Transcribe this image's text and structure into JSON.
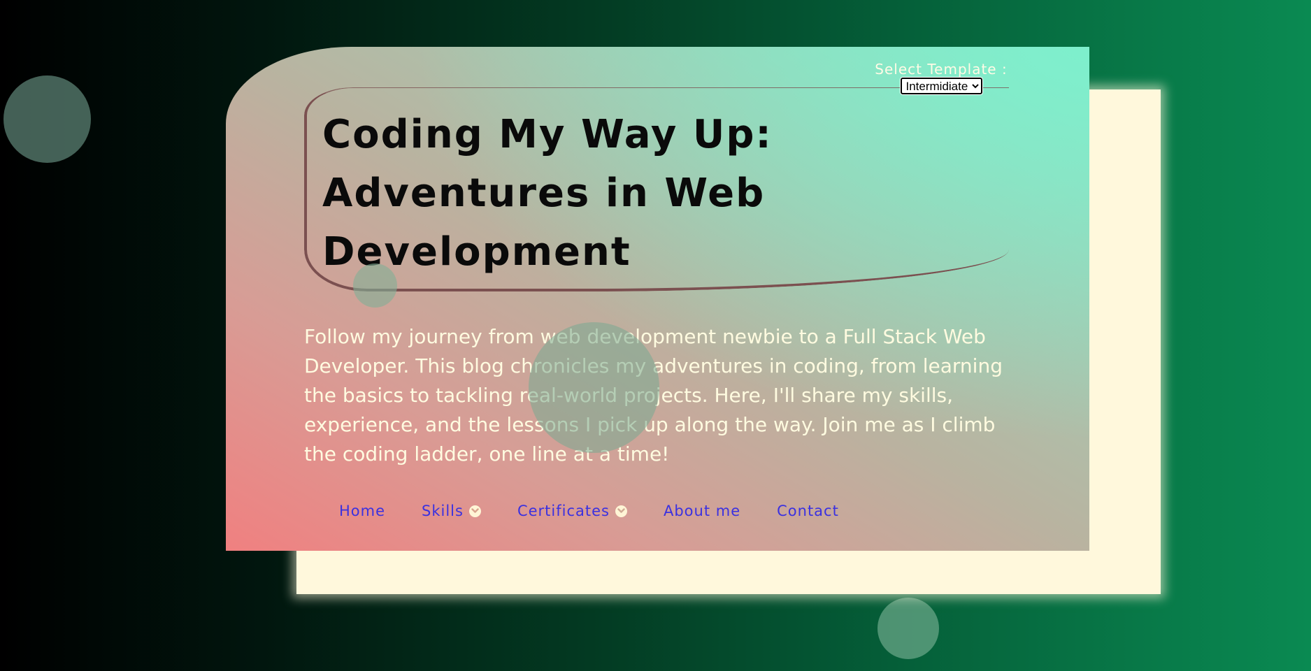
{
  "template_selector": {
    "label": "Select Template :",
    "selected": "Intermidiate",
    "options": [
      "Intermidiate"
    ]
  },
  "hero": {
    "title": "Coding My Way Up: Adventures in Web Development",
    "intro": "Follow my journey from web development newbie to a Full Stack Web Developer. This blog chronicles my adventures in coding, from learning the basics to tackling real-world projects. Here, I'll share my skills, experience, and the lessons I pick up along the way. Join me as I climb the coding ladder, one line at a time!"
  },
  "nav": {
    "items": [
      {
        "label": "Home",
        "dropdown": false
      },
      {
        "label": "Skills",
        "dropdown": true
      },
      {
        "label": "Certificates",
        "dropdown": true
      },
      {
        "label": "About me",
        "dropdown": false
      },
      {
        "label": "Contact",
        "dropdown": false
      }
    ]
  },
  "icons": {
    "dropdown": "chevron-down-circle-icon"
  },
  "colors": {
    "nav_link": "#3b31e0",
    "title": "#0a0a0a",
    "intro_text": "#fffbe0",
    "back_card": "#fff8dc",
    "frame_line": "#7b5050"
  }
}
